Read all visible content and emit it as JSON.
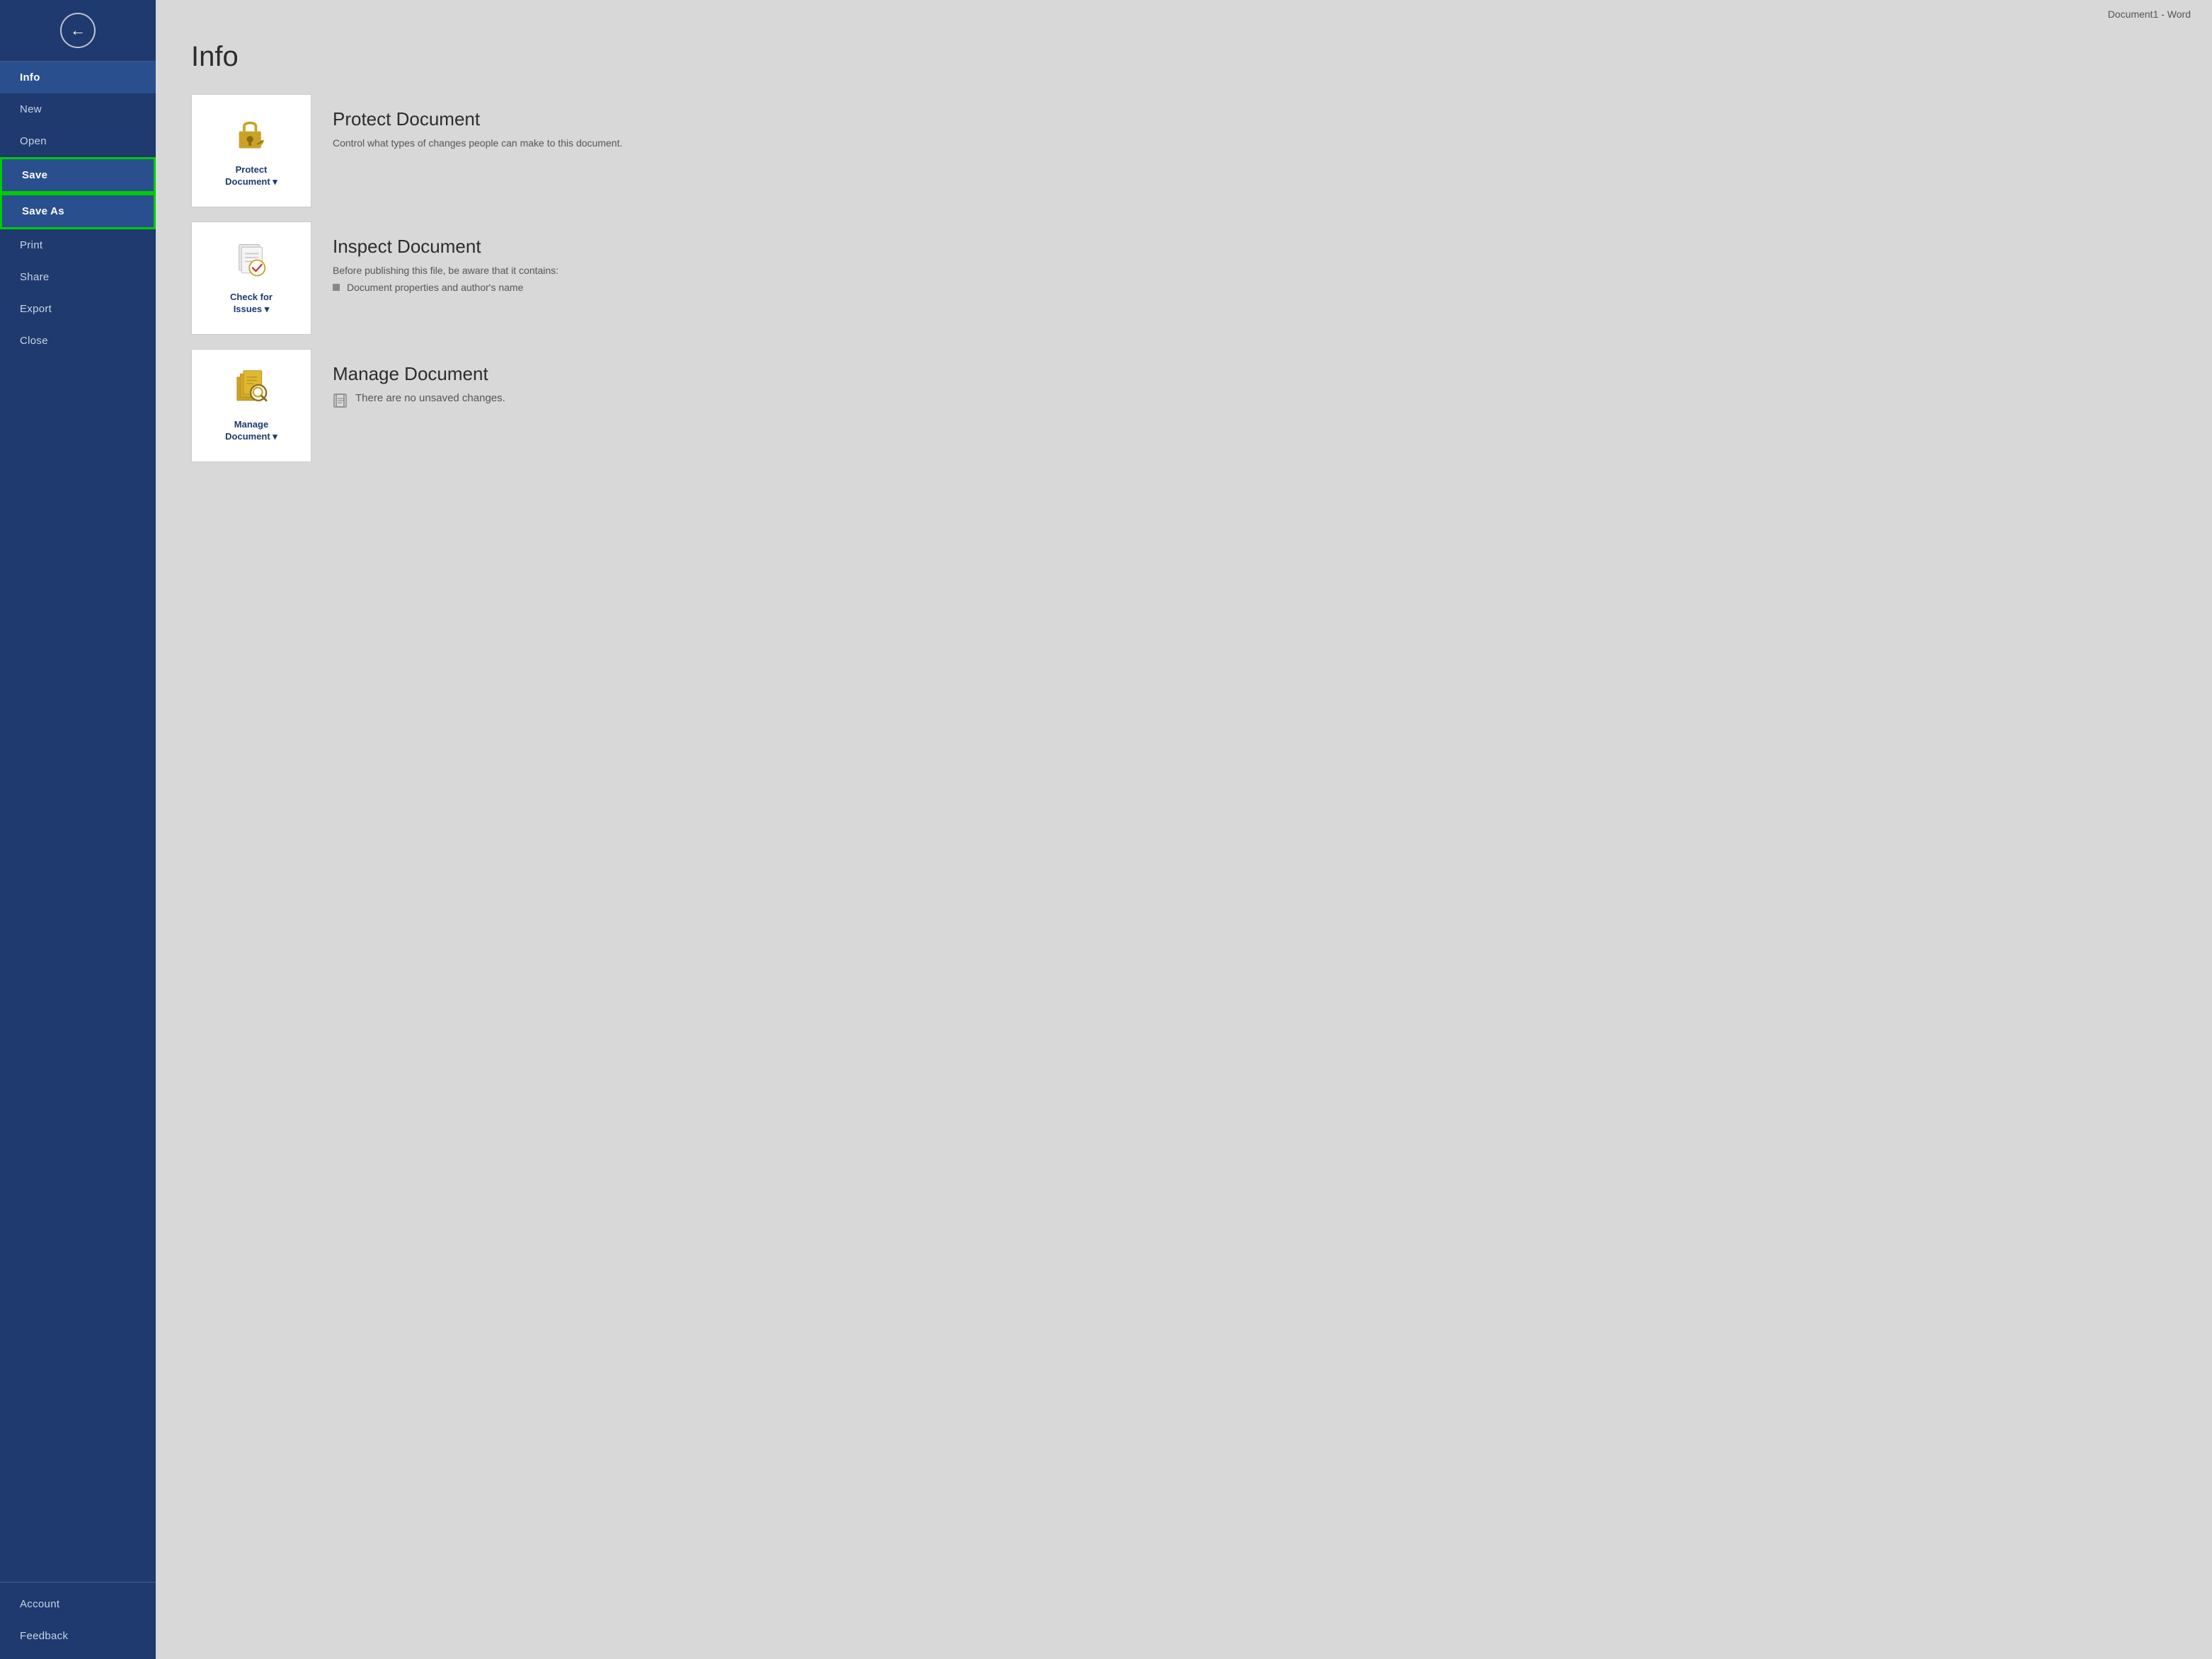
{
  "title_bar": {
    "text": "Document1  -  Word"
  },
  "sidebar": {
    "back_button_label": "←",
    "items": [
      {
        "id": "info",
        "label": "Info",
        "active": true,
        "highlighted": false
      },
      {
        "id": "new",
        "label": "New",
        "active": false,
        "highlighted": false
      },
      {
        "id": "open",
        "label": "Open",
        "active": false,
        "highlighted": false
      },
      {
        "id": "save",
        "label": "Save",
        "active": false,
        "highlighted": true
      },
      {
        "id": "saveas",
        "label": "Save As",
        "active": false,
        "highlighted": true
      },
      {
        "id": "print",
        "label": "Print",
        "active": false,
        "highlighted": false
      },
      {
        "id": "share",
        "label": "Share",
        "active": false,
        "highlighted": false
      },
      {
        "id": "export",
        "label": "Export",
        "active": false,
        "highlighted": false
      },
      {
        "id": "close",
        "label": "Close",
        "active": false,
        "highlighted": false
      }
    ],
    "bottom_items": [
      {
        "id": "account",
        "label": "Account"
      },
      {
        "id": "feedback",
        "label": "Feedback"
      }
    ]
  },
  "main": {
    "page_title": "Info",
    "cards": [
      {
        "id": "protect",
        "icon_label": "Protect\nDocument ▾",
        "title": "Protect Document",
        "description": "Control what types of changes people can make to this document.",
        "details": []
      },
      {
        "id": "inspect",
        "icon_label": "Check for\nIssues ▾",
        "title": "Inspect Document",
        "description": "Before publishing this file, be aware that it contains:",
        "details": [
          "Document properties and author's name"
        ]
      },
      {
        "id": "manage",
        "icon_label": "Manage\nDocument ▾",
        "title": "Manage Document",
        "description": "",
        "details": [
          "There are no unsaved changes."
        ]
      }
    ]
  }
}
